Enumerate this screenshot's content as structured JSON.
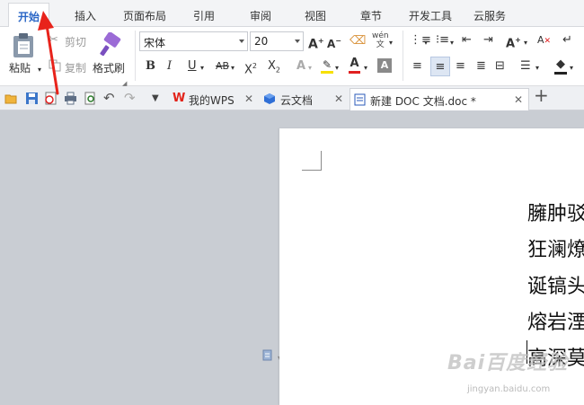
{
  "menu": {
    "tabs": [
      "开始",
      "插入",
      "页面布局",
      "引用",
      "审阅",
      "视图",
      "章节",
      "开发工具",
      "云服务"
    ],
    "active_index": 0
  },
  "ribbon": {
    "paste_label": "粘贴",
    "cut_label": "剪切",
    "copy_label": "复制",
    "format_painter_label": "格式刷",
    "font_name": "宋体",
    "font_size": "20"
  },
  "doc_tabs": [
    {
      "label": "我的WPS",
      "icon": "wps-logo-icon",
      "color": "#e2231a"
    },
    {
      "label": "云文档",
      "icon": "cloud-doc-icon",
      "color": "#2f6fd6"
    },
    {
      "label": "新建 DOC 文档.doc *",
      "icon": "doc-file-icon",
      "color": "#2a5ab8"
    }
  ],
  "document": {
    "lines": [
      "臃肿驳",
      "狂澜燎",
      "诞镐头",
      "熔岩湮",
      "高深莫"
    ]
  },
  "watermark": {
    "text": "Bai百度经验",
    "url_text": "jingyan.baidu.com"
  },
  "colors": {
    "active_tab_text": "#2a66c6",
    "annotation_arrow": "#e8231b",
    "highlight_yellow": "#f7e000",
    "font_color_red": "#e02020"
  }
}
